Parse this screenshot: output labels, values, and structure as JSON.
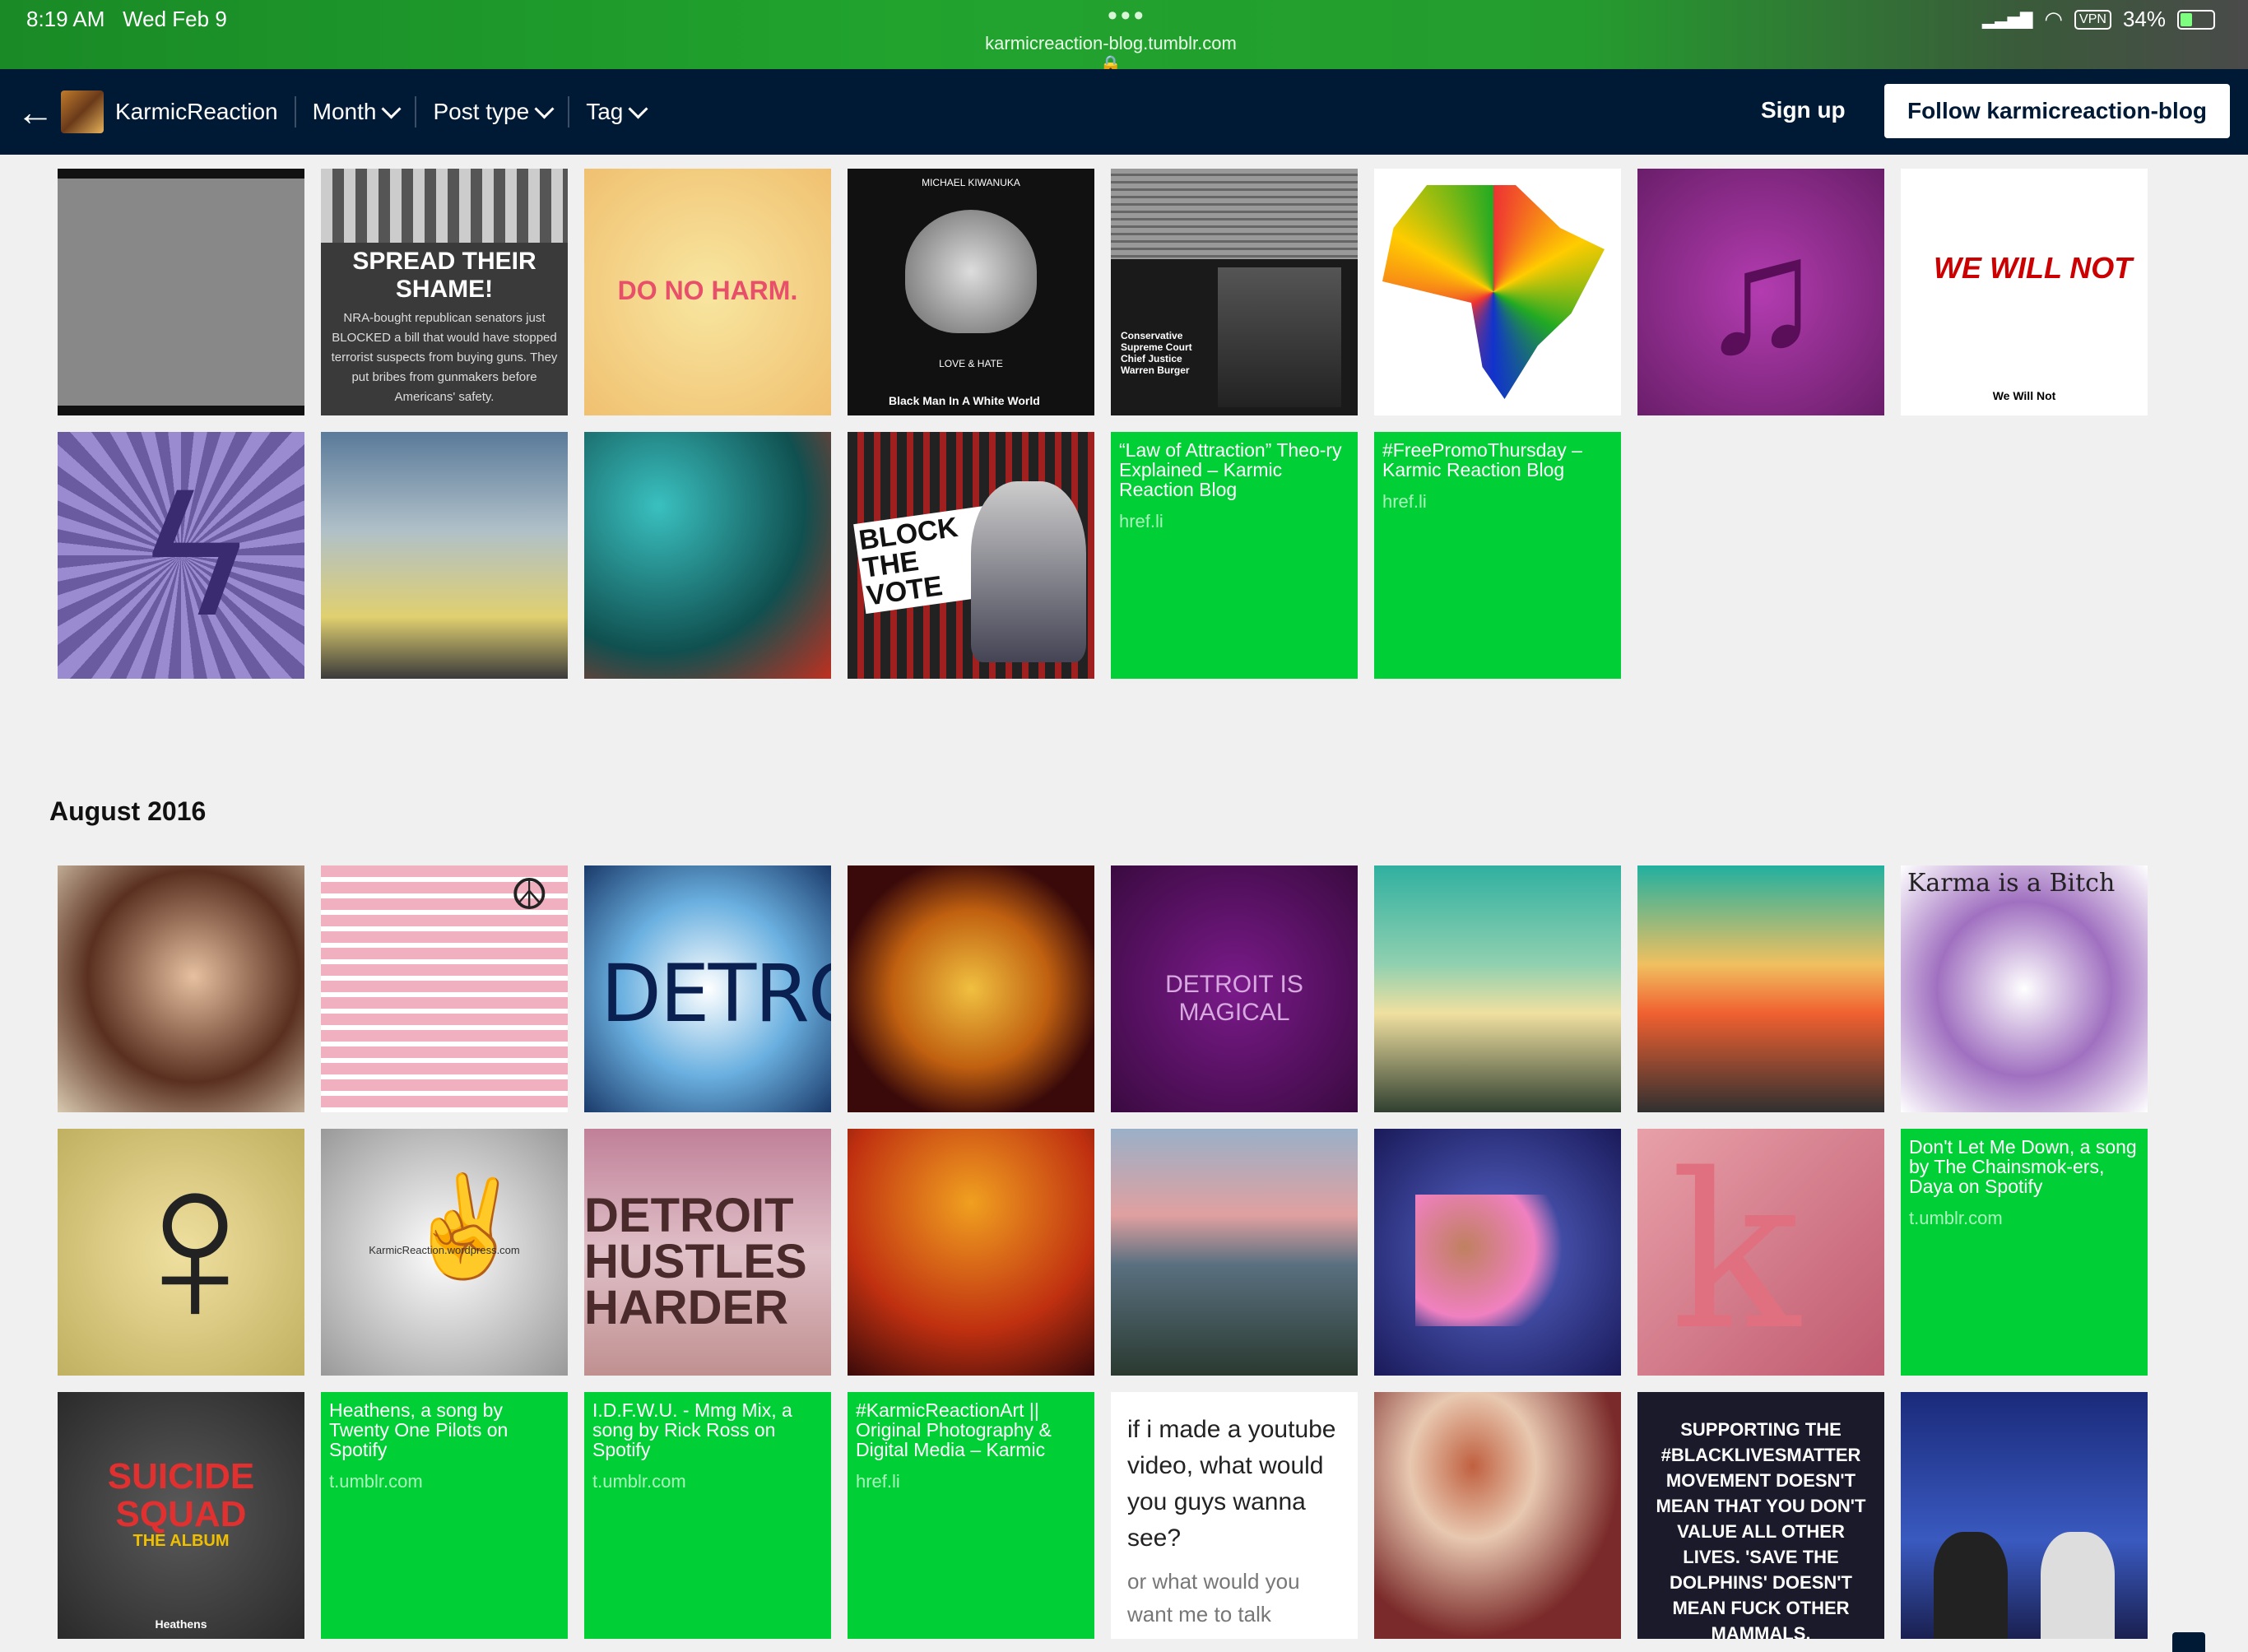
{
  "status": {
    "time": "8:19 AM",
    "date": "Wed Feb 9",
    "url": "karmicreaction-blog.tumblr.com",
    "vpn": "VPN",
    "battery": "34%"
  },
  "nav": {
    "blog_name": "KarmicReaction",
    "filters": [
      "Month",
      "Post type",
      "Tag"
    ],
    "sign_up": "Sign up",
    "follow": "Follow karmicreaction-blog"
  },
  "section_title": "August 2016",
  "tile_text": {
    "spread": "SPREAD THEIR SHAME!",
    "spread_body": "NRA-bought republican senators just BLOCKED a bill that would have stopped terrorist suspects from buying guns. They put bribes from gunmakers before Americans' safety.",
    "do_no_harm": "DO NO HARM.",
    "kiwanuka_top": "MICHAEL KIWANUKA",
    "kiwanuka_mid": "LOVE & HATE",
    "kiwanuka_bottom": "Black Man In A White World",
    "burger": "Conservative Supreme Court Chief Justice Warren Burger",
    "we_will_not": "WE WILL NOT",
    "we_will_not_caption": "We Will Not",
    "block_the_vote": "BLOCK THE VOTE",
    "detroit": "DETROIT",
    "detroit_magical": "DETROIT IS MAGICAL",
    "karma": "Karma is a Bitch",
    "wordpress": "KarmicReaction.wordpress.com",
    "detroit_hustles": "DETROIT HUSTLES HARDER",
    "suicide_squad": "SUICIDE SQUAD",
    "the_album": "THE ALBUM",
    "heathens_caption": "Heathens",
    "blm": "SUPPORTING THE #BLACKLIVESMATTER MOVEMENT DOESN'T MEAN THAT YOU DON'T VALUE ALL OTHER LIVES. 'SAVE THE DOLPHINS' DOESN'T MEAN FUCK OTHER MAMMALS."
  },
  "link_posts": [
    {
      "title": "“Law of Attraction” Theo-ry Explained – Karmic Reaction Blog",
      "domain": "href.li"
    },
    {
      "title": "#FreePromoThursday – Karmic Reaction Blog",
      "domain": "href.li"
    },
    {
      "title": "Don't Let Me Down, a song by The Chainsmok-ers, Daya on Spotify",
      "domain": "t.umblr.com"
    },
    {
      "title": "Heathens, a song by Twenty One Pilots on Spotify",
      "domain": "t.umblr.com"
    },
    {
      "title": "I.D.F.W.U. - Mmg Mix, a song by Rick Ross on Spotify",
      "domain": "t.umblr.com"
    },
    {
      "title": "#KarmicReactionArt || Original Photography & Digital Media – Karmic",
      "domain": "href.li"
    }
  ],
  "text_post": {
    "headline": "if i made a youtube video, what would you guys wanna see?",
    "body": "or what would you want me to talk"
  }
}
